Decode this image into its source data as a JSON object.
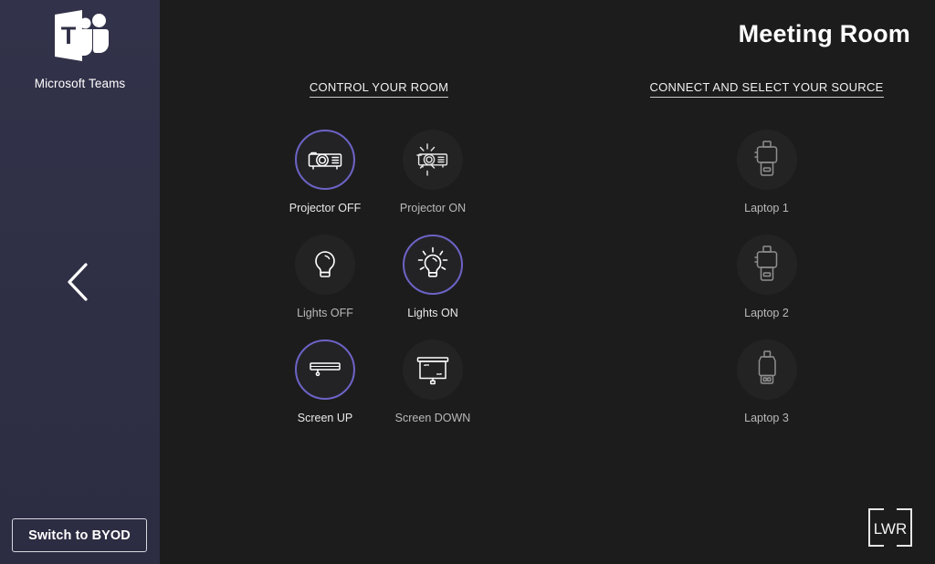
{
  "sidebar": {
    "brand_name": "Microsoft Teams",
    "logo_icon": "microsoft-teams-logo",
    "back_icon": "chevron-left-icon",
    "byod_button_label": "Switch to BYOD"
  },
  "header": {
    "room_title": "Meeting Room"
  },
  "colors": {
    "accent": "#6c63c6",
    "sidebar_bg": "#2f2f46",
    "main_bg": "#1c1c1c",
    "tile_bg": "#262626",
    "text": "#ffffff"
  },
  "columns": [
    {
      "heading": "CONTROL YOUR ROOM",
      "tiles": [
        {
          "label": "Projector OFF",
          "icon": "projector-off-icon",
          "active": true
        },
        {
          "label": "Projector ON",
          "icon": "projector-on-icon",
          "active": false
        },
        {
          "label": "Lights OFF",
          "icon": "lightbulb-off-icon",
          "active": false
        },
        {
          "label": "Lights ON",
          "icon": "lightbulb-on-icon",
          "active": true
        },
        {
          "label": "Screen UP",
          "icon": "screen-up-icon",
          "active": true
        },
        {
          "label": "Screen DOWN",
          "icon": "screen-down-icon",
          "active": false
        }
      ]
    },
    {
      "heading": "CONNECT AND SELECT YOUR SOURCE",
      "tiles": [
        {
          "label": "Laptop 1",
          "icon": "connector-plug-icon",
          "active": false
        },
        {
          "label": "Laptop 2",
          "icon": "connector-plug-icon",
          "active": false
        },
        {
          "label": "Laptop 3",
          "icon": "connector-plug-alt-icon",
          "active": false
        }
      ]
    }
  ],
  "footer": {
    "logo_text": "LWR",
    "logo_icon": "lwr-logo"
  }
}
